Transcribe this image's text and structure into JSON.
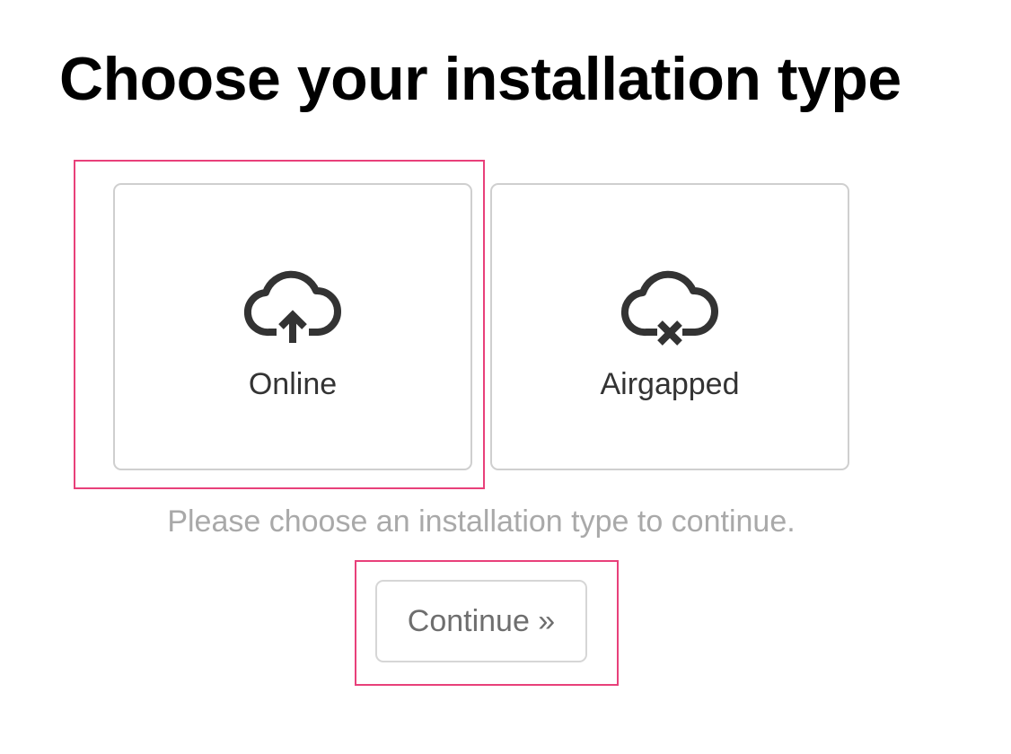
{
  "page": {
    "title": "Choose your installation type",
    "hint": "Please choose an installation type to continue."
  },
  "options": [
    {
      "label": "Online",
      "icon": "cloud-upload-icon",
      "highlighted": true
    },
    {
      "label": "Airgapped",
      "icon": "cloud-offline-icon",
      "highlighted": false
    }
  ],
  "continue_button": {
    "label": "Continue »",
    "highlighted": true
  },
  "colors": {
    "highlight": "#e8407a",
    "card_border": "#cfcfcf",
    "icon": "#333333",
    "hint_text": "#a9a9a9",
    "button_text": "#6e6e6e"
  }
}
